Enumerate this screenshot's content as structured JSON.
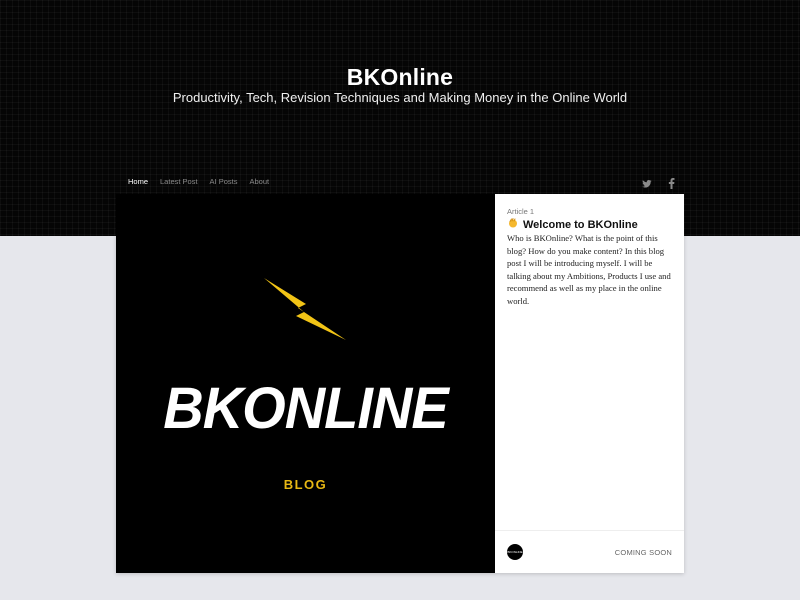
{
  "site": {
    "title": "BKOnline",
    "tagline": "Productivity, Tech, Revision Techniques and Making Money in the Online World"
  },
  "nav": {
    "items": [
      {
        "label": "Home",
        "active": true
      },
      {
        "label": "Latest Post",
        "active": false
      },
      {
        "label": "AI Posts",
        "active": false
      },
      {
        "label": "About",
        "active": false
      }
    ]
  },
  "social": {
    "icons": [
      "twitter-icon",
      "facebook-icon"
    ]
  },
  "card": {
    "image": {
      "logo_text": "BKONLINE",
      "label": "BLOG",
      "accent": "#e8b813"
    },
    "category": "Article 1",
    "title": "Welcome to BKOnline",
    "title_icon": "waving-hand-icon",
    "excerpt": "Who is BKOnline? What is the point of this blog? How do you make content? In this blog post I will be introducing myself. I will be talking about my Ambitions, Products I use and recommend as well as my place in the online world.",
    "avatar_text": "BKONLINE",
    "status": "COMING SOON"
  }
}
